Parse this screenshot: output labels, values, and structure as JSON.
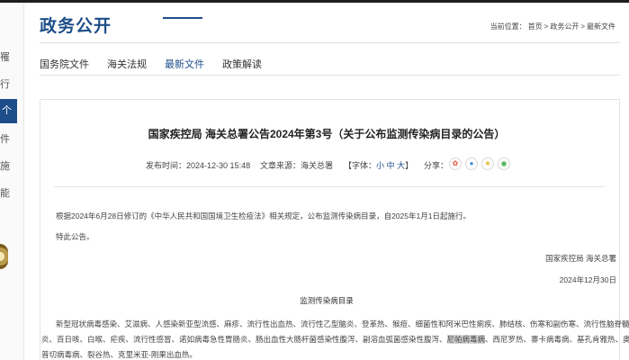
{
  "sidebar": {
    "fragments": [
      "罹",
      "行",
      "件",
      "行",
      "施",
      "能"
    ],
    "active_label": "个"
  },
  "header": {
    "title": "政务公开",
    "breadcrumb": {
      "prefix": "当前位置：",
      "items": [
        "首页",
        "政务公开",
        "最新文件"
      ],
      "separator": ">"
    }
  },
  "tabs": [
    {
      "label": "国务院文件",
      "active": false
    },
    {
      "label": "海关法规",
      "active": false
    },
    {
      "label": "最新文件",
      "active": true
    },
    {
      "label": "政策解读",
      "active": false
    }
  ],
  "article": {
    "title": "国家疾控局 海关总署公告2024年第3号（关于公布监测传染病目录的公告）",
    "publish_label": "发布时间：",
    "publish_time": "2024-12-30 15:48",
    "source_label": "文章来源：",
    "source": "海关总署",
    "font_label": "【字体：",
    "font_small": "小",
    "font_medium": "中",
    "font_large": "大",
    "font_close": "】",
    "share_label": "分享：",
    "share_icons": [
      "weibo-icon",
      "qq-icon",
      "qzone-icon",
      "wechat-icon"
    ],
    "share_colors": [
      "#e0563b",
      "#3a8fd8",
      "#e7b528",
      "#3fae4a"
    ],
    "body_p1": "根据2024年6月28日修订的《中华人民共和国国境卫生检疫法》相关规定，公布监测传染病目录，自2025年1月1日起施行。",
    "body_p2": "特此公告。",
    "signature": "国家疾控局 海关总署",
    "signature_date": "2024年12月30日",
    "list_title": "监测传染病目录",
    "list_line1": "新型冠状病毒感染、艾滋病、人感染新亚型流感、麻疹、流行性出血热、流行性乙型脑炎、登革热、猴痘、细菌性和阿米巴性痢疾、肺结核、伤寒和副伤寒、流行性脑脊髓膜",
    "list_line2_a": "炎、百日咳、白喉、疟疾、流行性感冒、诺如病毒急性胃肠炎、肠出血性大肠杆菌感染性腹泻、副溶血弧菌感染性腹泻、",
    "list_line2_hl": "尼帕病毒病",
    "list_line2_b": "、西尼罗热、寨卡病毒病、基孔肯雅热、奥罗",
    "list_line3": "普切病毒病、裂谷热、克里米亚-刚果出血热。"
  }
}
